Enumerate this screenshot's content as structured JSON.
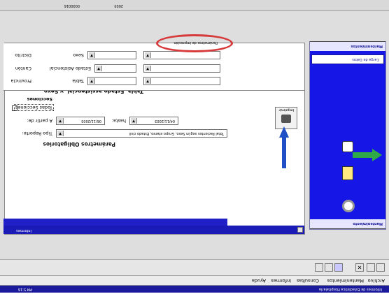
{
  "colors": {
    "titlebar": "#1b1bb8",
    "panel_blue": "#1616e6",
    "header_blue": "#2020c8",
    "status_bar": "#1a1a9a",
    "annotation_red": "#d63a3a",
    "annotation_green": "#2fa84a",
    "annotation_blue": "#1f4fc4"
  },
  "window": {
    "top_title": "Informes"
  },
  "form": {
    "header_title": "Parámetros Obligatorios",
    "tipo_reporte_label": "Tipo Reporte:",
    "tipo_reporte_value": "Total Pacientes según Sexo, Grupo etareo, Estado civil",
    "a_partir_label": "A partir de:",
    "a_partir_value": "06/11/2003",
    "hasta_label": "hasta:",
    "hasta_value": "04/11/2003",
    "print_label": "Imprimir",
    "todas_label": "Todas Secciones",
    "secciones_label": "Secciones",
    "table_title": "Tabla, Estado assistencial, y Sexo",
    "tabla_label": "Tabla",
    "provincia_label": "Provincia",
    "sexo_label": "Sexo",
    "estado_asistencial_label": "Estado Asistencial",
    "canton_label": "Cantón",
    "distrito_label": "Distrito",
    "tab_label": "Parámetros de impresión"
  },
  "left_panel": {
    "header_top": "Mantenimientos",
    "item_1": "Carga de Datos",
    "bottom_label": "Mantenimiento"
  },
  "toolbar": {
    "btn_1": "",
    "btn_2": ""
  },
  "status": {
    "left_text": "Informes de Estadistica Hospitalaria",
    "right_text": "PM 5:16"
  },
  "menu": {
    "items": [
      "Archivo",
      "Mantenimientos",
      "Consultas",
      "Informes",
      "Ayuda"
    ]
  },
  "top_strip": {
    "text_1": "0000016",
    "text_2": "2003"
  }
}
